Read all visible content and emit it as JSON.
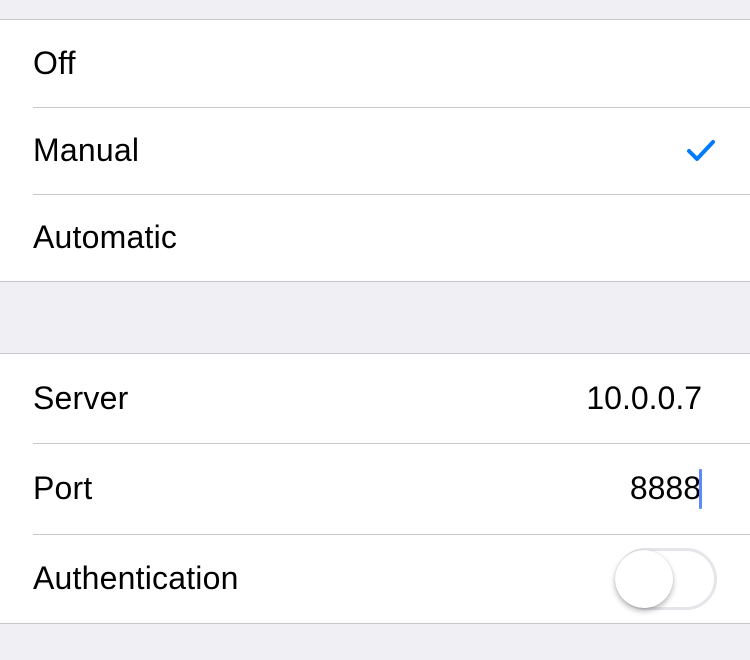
{
  "mode_options": {
    "off": {
      "label": "Off",
      "selected": false
    },
    "manual": {
      "label": "Manual",
      "selected": true
    },
    "automatic": {
      "label": "Automatic",
      "selected": false
    }
  },
  "proxy": {
    "server": {
      "label": "Server",
      "value": "10.0.0.7"
    },
    "port": {
      "label": "Port",
      "value": "8888"
    },
    "authentication": {
      "label": "Authentication",
      "enabled": false
    }
  },
  "colors": {
    "accent": "#007aff",
    "background": "#efeff4",
    "separator": "#c8c7cc",
    "caret": "#5b8cf5"
  },
  "icons": {
    "selected": "checkmark-icon"
  }
}
